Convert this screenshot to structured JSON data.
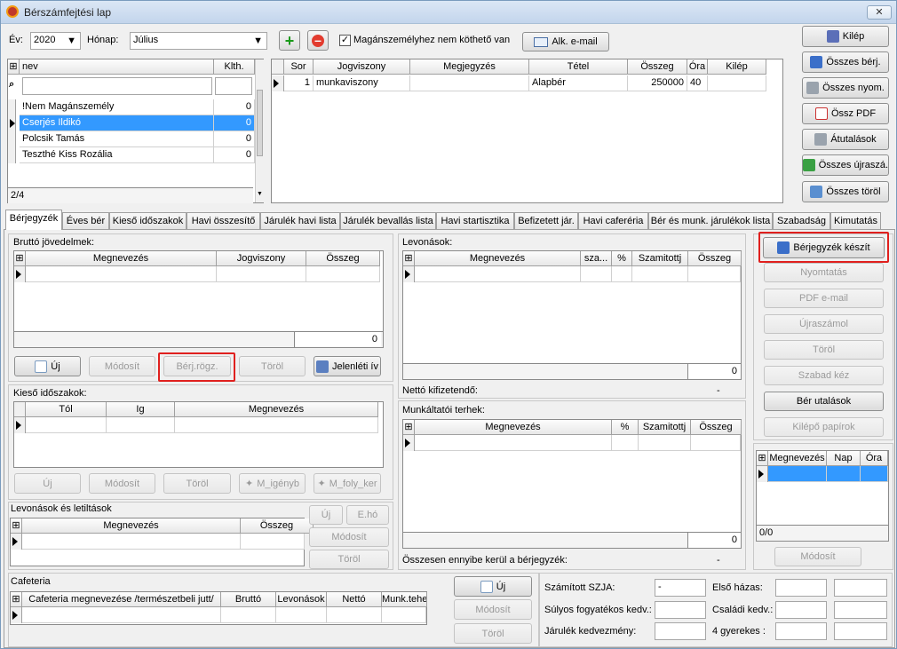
{
  "window": {
    "title": "Bérszámfejtési lap",
    "close": "✕"
  },
  "toolbar": {
    "year_label": "Év:",
    "year_value": "2020",
    "month_label": "Hónap:",
    "month_value": "Július",
    "private_label": "Magánszemélyhez nem köthető van",
    "email_label": "Alk. e-mail"
  },
  "employees": {
    "headers": [
      "nev",
      "Klth."
    ],
    "rows": [
      {
        "name": "!Nem Magánszemély",
        "klth": "0"
      },
      {
        "name": "Cserjés Ildikó",
        "klth": "0"
      },
      {
        "name": "Polcsik Tamás",
        "klth": "0"
      },
      {
        "name": "Teszthé Kiss Rozália",
        "klth": "0"
      }
    ],
    "counter": "2/4"
  },
  "contracts": {
    "headers": [
      "Sor",
      "Jogviszony",
      "Megjegyzés",
      "Tétel",
      "Összeg",
      "Óra",
      "Kilép"
    ],
    "rows": [
      {
        "sor": "1",
        "jogviszony": "munkaviszony",
        "megjegyzes": "",
        "tetel": "Alapbér",
        "osszeg": "250000",
        "ora": "40",
        "kilep": ""
      }
    ]
  },
  "right_buttons": [
    "Kilép",
    "Összes bérj.",
    "Összes nyom.",
    "Össz PDF",
    "Átutalások",
    "Összes újraszá.",
    "Összes töröl"
  ],
  "tabs": [
    "Bérjegyzék",
    "Éves bér",
    "Kieső időszakok",
    "Havi összesítő",
    "Járulék havi lista",
    "Járulék bevallás lista",
    "Havi startisztika",
    "Befizetett jár.",
    "Havi caferéria",
    "Bér és munk. járulékok lista",
    "Szabadság",
    "Kimutatás"
  ],
  "gross": {
    "title": "Bruttó jövedelmek:",
    "headers": [
      "Megnevezés",
      "Jogviszony",
      "Összeg"
    ],
    "total": "0",
    "buttons": {
      "new": "Új",
      "edit": "Módosít",
      "record": "Bérj.rögz.",
      "delete": "Töröl",
      "attendance": "Jelenléti ív"
    }
  },
  "absence": {
    "title": "Kieső időszakok:",
    "headers": [
      "Tól",
      "Ig",
      "Megnevezés"
    ],
    "buttons": {
      "new": "Új",
      "edit": "Módosít",
      "delete": "Töröl",
      "m_igeny": "M_igényb",
      "m_foly": "M_foly_ker"
    }
  },
  "deductions_left": {
    "title": "Levonások és letiltások",
    "headers": [
      "Megnevezés",
      "Összeg"
    ],
    "buttons": {
      "new": "Új",
      "eho": "E.hó",
      "edit": "Módosít",
      "delete": "Töröl"
    }
  },
  "cafeteria": {
    "title": "Cafeteria",
    "headers": [
      "Cafeteria megnevezése /természetbeli jutt/",
      "Bruttó",
      "Levonások",
      "Nettó",
      "Munk.teher"
    ],
    "buttons": {
      "new": "Új",
      "edit": "Módosít",
      "delete": "Töröl"
    }
  },
  "deductions": {
    "title": "Levonások:",
    "headers": [
      "Megnevezés",
      "sza...",
      "%",
      "Szamitottj",
      "Összeg"
    ],
    "total": "0",
    "net_label": "Nettó kifizetendő:",
    "net_value": "-"
  },
  "employer": {
    "title": "Munkáltatói terhek:",
    "headers": [
      "Megnevezés",
      "%",
      "Szamitottj",
      "Összeg"
    ],
    "total": "0",
    "sum_label": "Összesen ennyibe kerül a bérjegyzék:",
    "sum_value": "-"
  },
  "tax": {
    "szja_label": "Számított SZJA:",
    "szja_value": "-",
    "fogy_label": "Súlyos fogyatékos kedv.:",
    "jarulek_label": "Járulék kedvezmény:",
    "elso_label": "Első házas:",
    "csaladi_label": "Családi kedv.:",
    "gyerek_label": "4 gyerekes :"
  },
  "payslip_buttons": [
    "Bérjegyzék készít",
    "Nyomtatás",
    "PDF e-mail",
    "Újraszámol",
    "Töröl",
    "Szabad kéz",
    "Bér utalások",
    "Kilépő papírok"
  ],
  "leave": {
    "headers": [
      "Megnevezés",
      "Nap",
      "Óra"
    ],
    "counter": "0/0",
    "edit": "Módosít"
  }
}
